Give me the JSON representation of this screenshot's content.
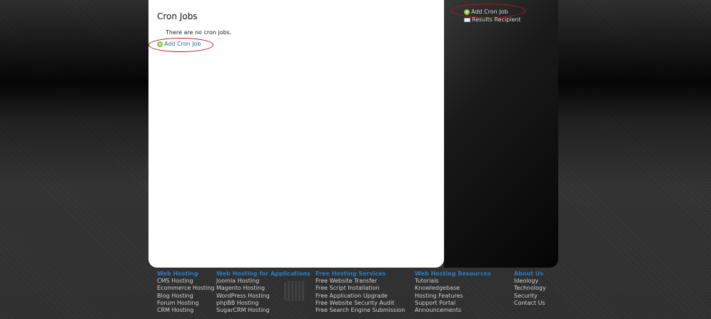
{
  "main": {
    "title": "Cron Jobs",
    "empty_message": "There are no cron jobs.",
    "add_link": "Add Cron Job"
  },
  "sidebar": {
    "items": [
      {
        "label": "Add Cron Job",
        "icon": "plus-circle-icon"
      },
      {
        "label": "Results Recipient",
        "icon": "envelope-icon"
      }
    ]
  },
  "footer": {
    "columns": [
      {
        "heading": "Web Hosting",
        "links": [
          "CMS Hosting",
          "Ecommerce Hosting",
          "Blog Hosting",
          "Forum Hosting",
          "CRM Hosting"
        ]
      },
      {
        "heading": "Web Hosting for Applications",
        "links": [
          "Joomla Hosting",
          "Magento Hosting",
          "WordPress Hosting",
          "phpBB Hosting",
          "SugarCRM Hosting"
        ]
      },
      {
        "heading": "Free Hosting Services",
        "links": [
          "Free Website Transfer",
          "Free Script Installation",
          "Free Application Upgrade",
          "Free Website Security Audit",
          "Free Search Engine Submission"
        ]
      },
      {
        "heading": "Web Hosting Resources",
        "links": [
          "Tutorials",
          "Knowledgebase",
          "Hosting Features",
          "Support Portal",
          "Announcements"
        ]
      },
      {
        "heading": "About Us",
        "links": [
          "Ideology",
          "Technology",
          "Security",
          "Contact Us"
        ]
      }
    ]
  },
  "colors": {
    "link": "#1f6fa8",
    "footer_heading": "#2b7cc2",
    "highlight_ellipse": "#c0111a",
    "plus_icon": "#8cc63f"
  }
}
